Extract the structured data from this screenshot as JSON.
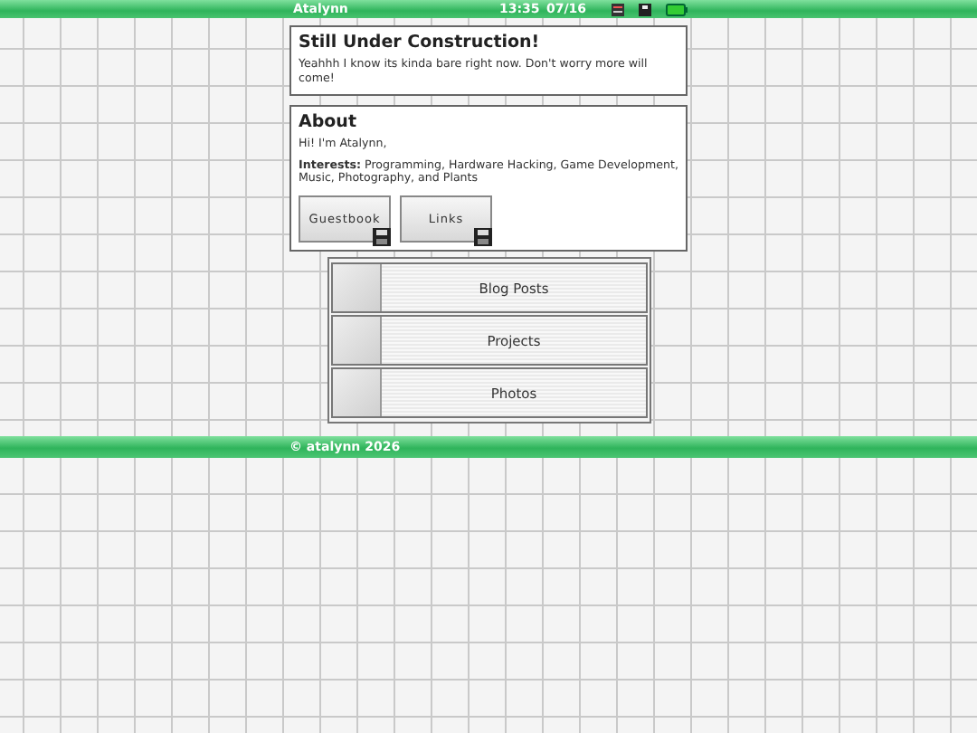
{
  "top_bar": {
    "title": "Atalynn",
    "time": "13:35",
    "date": "07/16"
  },
  "notice": {
    "title": "Still Under Construction!",
    "text": "Yeahhh I know its kinda bare right now. Don't worry more will come!"
  },
  "about": {
    "title": "About",
    "greeting": "Hi! I'm Atalynn,",
    "interests": "**Interests:** Programming, Hardware Hacking, Game Development, Music, Photography, and Plants",
    "buttons": [
      "Guestbook",
      "Links"
    ]
  },
  "menu": [
    "Blog Posts",
    "Projects",
    "Photos"
  ],
  "footer": "© atalynn 2026"
}
